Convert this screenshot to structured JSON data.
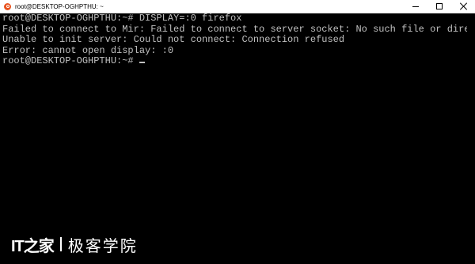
{
  "window": {
    "title": "root@DESKTOP-OGHPTHU: ~",
    "app_icon": "ubuntu-icon",
    "accent_color": "#e95420"
  },
  "terminal": {
    "lines": [
      "root@DESKTOP-OGHPTHU:~# DISPLAY=:0 firefox",
      "Failed to connect to Mir: Failed to connect to server socket: No such file or directory",
      "Unable to init server: Could not connect: Connection refused",
      "Error: cannot open display: :0",
      "root@DESKTOP-OGHPTHU:~# "
    ],
    "text_color": "#c0c0c0",
    "background": "#000000"
  },
  "watermark": {
    "logo": "IT之家",
    "text": "极客学院"
  }
}
